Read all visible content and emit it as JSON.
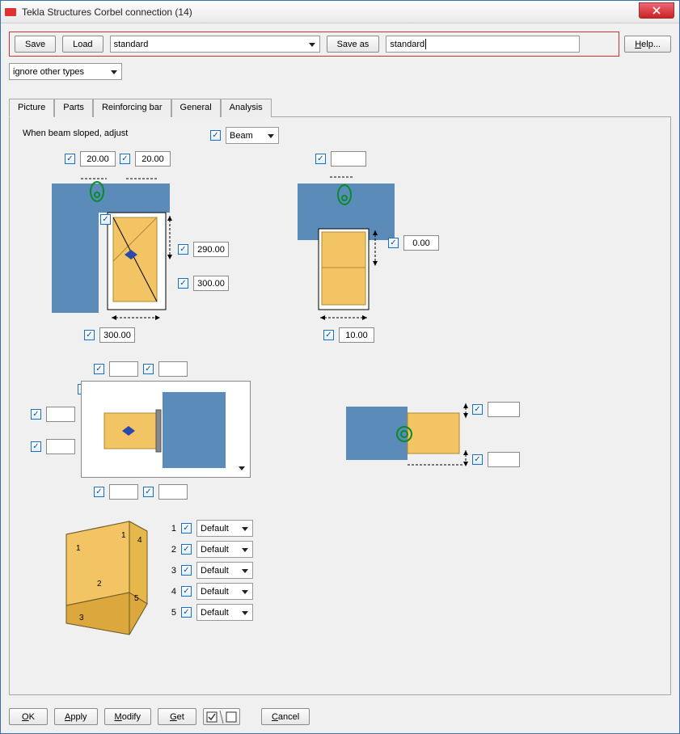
{
  "window": {
    "title": "Tekla Structures  Corbel connection (14)"
  },
  "toolbar": {
    "save": "Save",
    "load": "Load",
    "saveas": "Save as",
    "help": "Help...",
    "preset_sel": "standard",
    "preset_txt": "standard"
  },
  "filter_sel": "ignore other types",
  "tabs": [
    "Picture",
    "Parts",
    "Reinforcing bar",
    "General",
    "Analysis"
  ],
  "sloped_label": "When beam sloped, adjust",
  "sloped_sel": "Beam",
  "d1": {
    "top_left": "20.00",
    "top_right": "20.00",
    "r1": "290.00",
    "r2": "300.00",
    "bottom": "300.00"
  },
  "d2": {
    "top": "",
    "right": "0.00",
    "bottom": "10.00"
  },
  "d3": {
    "t1": "",
    "t2": "",
    "l1": "",
    "l2": "",
    "b1": "",
    "b2": ""
  },
  "d4": {
    "rtop": "",
    "rbot": ""
  },
  "chamfer": {
    "nums": [
      "1",
      "2",
      "3",
      "4",
      "5"
    ],
    "items": [
      {
        "n": "1",
        "v": "Default"
      },
      {
        "n": "2",
        "v": "Default"
      },
      {
        "n": "3",
        "v": "Default"
      },
      {
        "n": "4",
        "v": "Default"
      },
      {
        "n": "5",
        "v": "Default"
      }
    ]
  },
  "bottom": {
    "ok": "OK",
    "apply": "Apply",
    "modify": "Modify",
    "get": "Get",
    "cancel": "Cancel"
  }
}
